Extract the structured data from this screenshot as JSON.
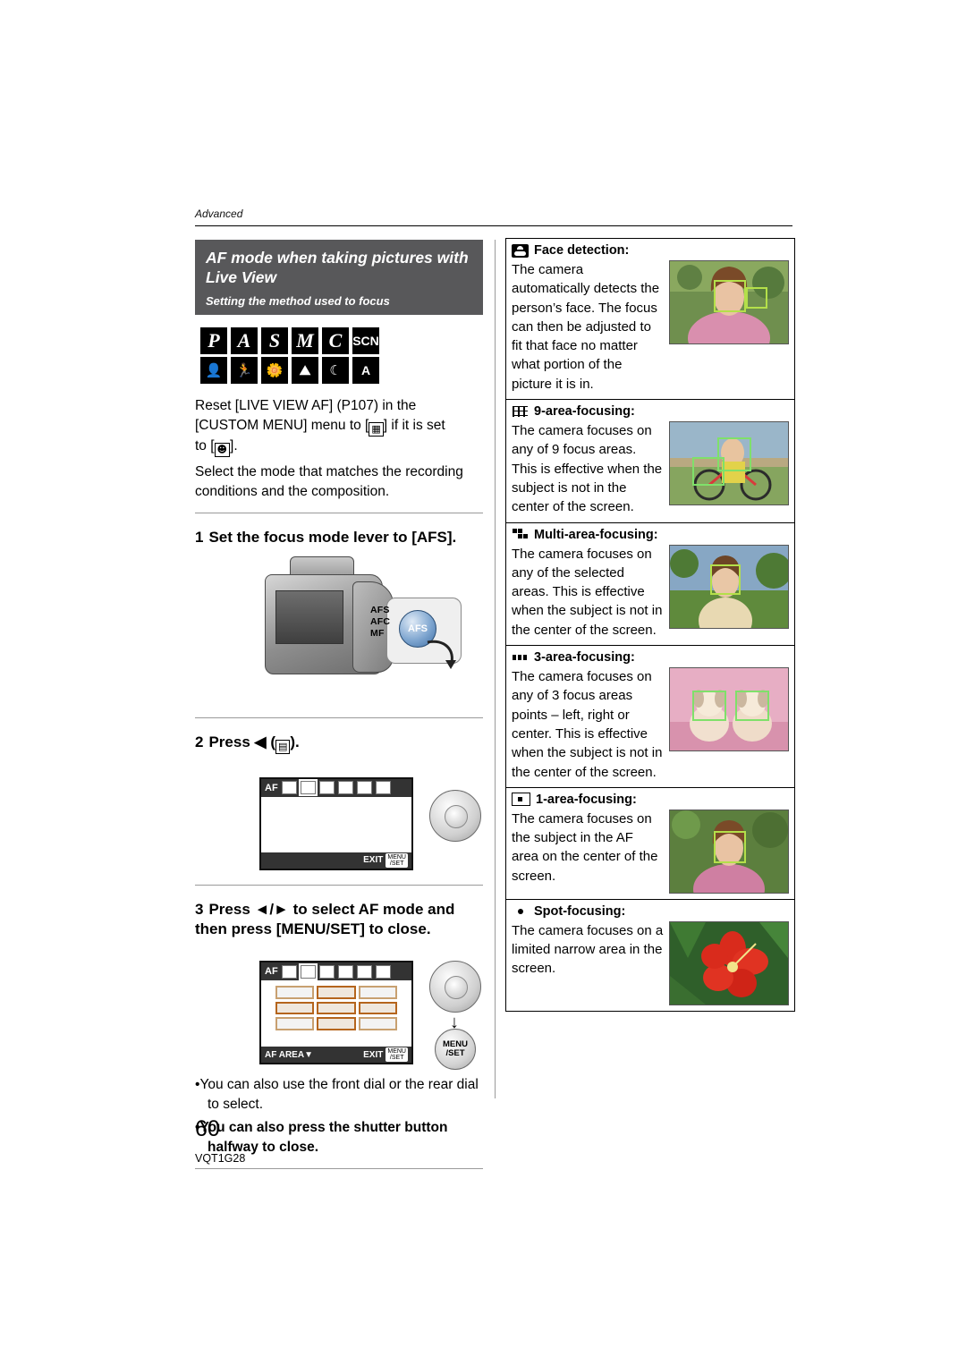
{
  "header": {
    "section": "Advanced"
  },
  "left": {
    "title_main": "AF mode when taking pictures with Live View",
    "title_sub": "Setting the method used to focus",
    "modes_row1": [
      "P",
      "A",
      "S",
      "M",
      "C",
      "SCN"
    ],
    "modes_row2": [
      "portrait-icon",
      "sports-icon",
      "macro-icon",
      "scenery-icon",
      "night-portrait-icon",
      "A"
    ],
    "para1": "Reset [LIVE VIEW AF] (P107) in the [CUSTOM MENU] menu to [ ] if it is set to [ ].",
    "para1_part1": "Reset [LIVE VIEW AF] (P107) in the",
    "para1_part2": "[CUSTOM MENU] menu to [",
    "para1_part3": "] if it is set",
    "para1_part4": "to [",
    "para1_part5": "].",
    "para2": "Select the mode that matches the recording conditions and the composition.",
    "step1_num": "1",
    "step1_text": "Set the focus mode lever to [AFS].",
    "lever_labels": [
      "AFS",
      "AFC",
      "MF"
    ],
    "lever_knob": "AFS",
    "step2_num": "2",
    "step2_text": "Press ◄ (      ).",
    "step2_prefix": "Press",
    "step3_num": "3",
    "step3_text": "Press ◄/► to select AF mode and then press [MENU/SET] to close.",
    "lcd1": {
      "af_label": "AF",
      "exit_label": "EXIT",
      "menuset_label": "MENU\n/SET"
    },
    "lcd2": {
      "af_label": "AF",
      "area_label": "AF AREA",
      "exit_label": "EXIT"
    },
    "dpad_label": "MENU /SET",
    "menu_btn_line1": "MENU",
    "menu_btn_line2": "/SET",
    "bullet1": "You can also use the front dial or the rear dial to select.",
    "bullet2": "You can also press the shutter button halfway to close."
  },
  "right": {
    "rows": [
      {
        "icon": "face-detection-icon",
        "heading": "Face detection:",
        "text": "The camera automatically detects the person’s face. The focus can then be adjusted to fit that face no matter what portion of the picture it is in.",
        "image": "photo-woman-with-face-frames"
      },
      {
        "icon": "9-area-focus-icon",
        "heading": "9-area-focusing:",
        "text": "The camera focuses on any of 9 focus areas. This is effective when the subject is not in the center of the screen.",
        "image": "photo-child-with-bicycle"
      },
      {
        "icon": "multi-area-focus-icon",
        "heading": "Multi-area-focusing:",
        "text": "The camera focuses on any of the selected areas. This is effective when the subject is not in the center of the screen.",
        "image": "photo-girl-outdoors"
      },
      {
        "icon": "3-area-focus-icon",
        "heading": "3-area-focusing:",
        "text": "The camera focuses on any of 3 focus areas points – left, right or center. This is effective when the subject is not in the center of the screen.",
        "image": "photo-two-puppies"
      },
      {
        "icon": "1-area-focus-icon",
        "heading": "1-area-focusing:",
        "text": "The camera focuses on the subject in the AF area on the center of the screen.",
        "image": "photo-woman-portrait"
      },
      {
        "icon": "spot-focus-icon",
        "heading": "Spot-focusing:",
        "text": "The camera focuses on a limited narrow area in the screen.",
        "image": "photo-red-hibiscus"
      }
    ]
  },
  "footer": {
    "page_number": "60",
    "doc_id": "VQT1G28"
  }
}
